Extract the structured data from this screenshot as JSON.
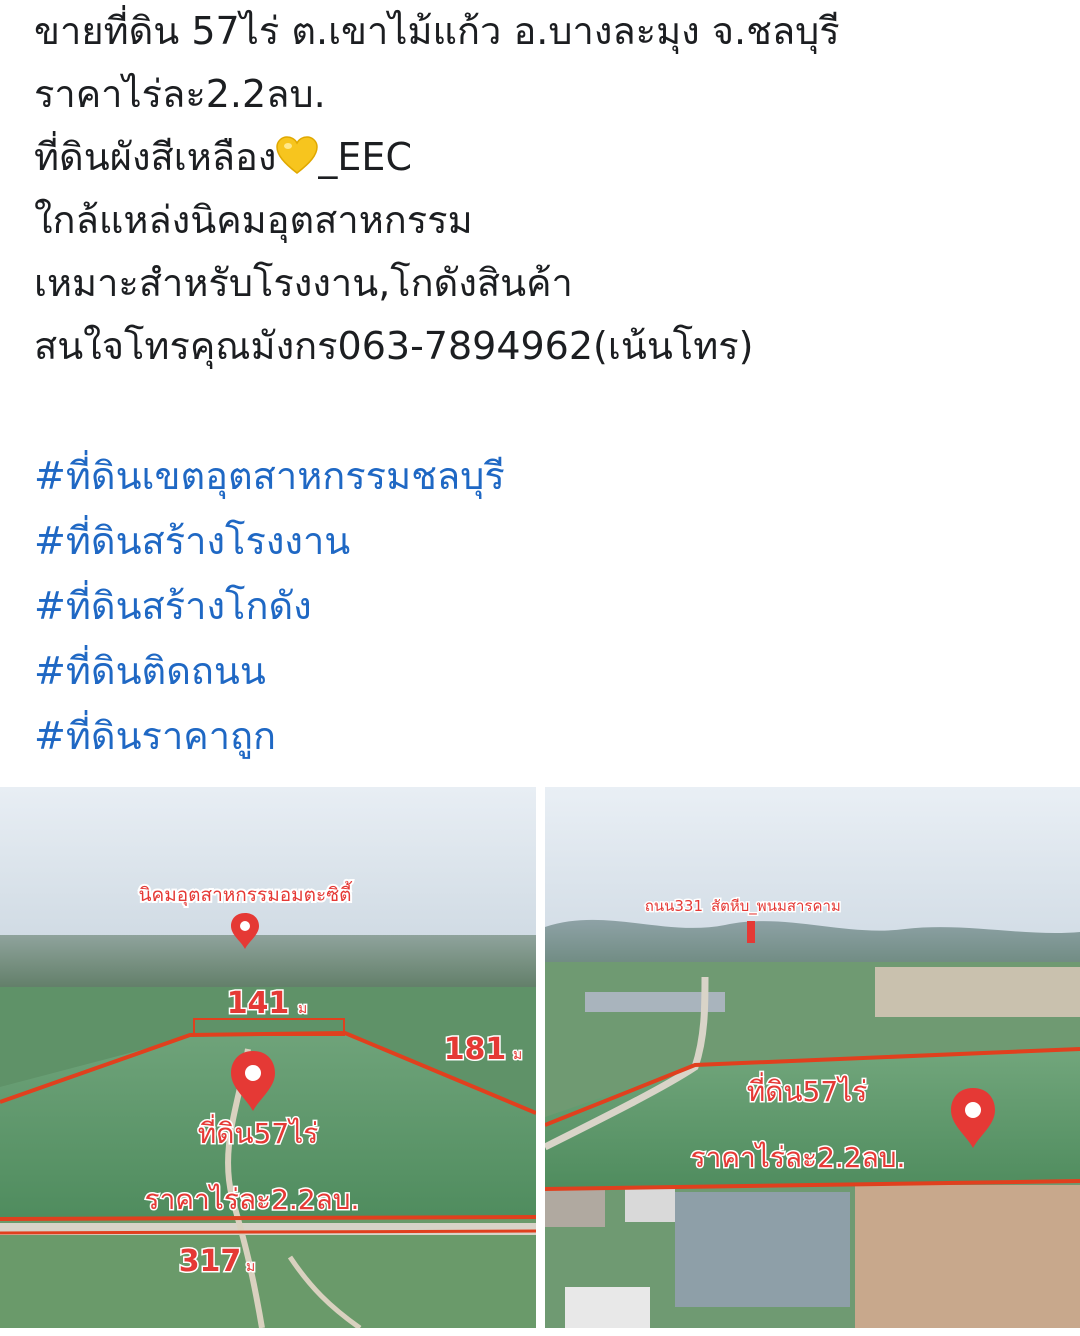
{
  "post": {
    "lines": [
      "ขายที่ดิน 57ไร่ ต.เขาไม้แก้ว อ.บางละมุง จ.ชลบุรี",
      "ราคาไร่ละ2.2ลบ.",
      "ที่ดินผังสีเหลือง",
      "ใกล้แหล่งนิคมอุตสาหกรรม",
      "เหมาะสำหรับโรงงาน,โกดังสินค้า",
      "สนใจโทรคุณมังกร063-7894962(เน้นโทร)"
    ],
    "line3_suffix": "_EEC",
    "hashtags": [
      "#ที่ดินเขตอุตสาหกรรมชลบุรี",
      "#ที่ดินสร้างโรงงาน",
      "#ที่ดินสร้างโกดัง",
      "#ที่ดินติดถนน",
      "#ที่ดินราคาถูก"
    ],
    "hashtag_color": "#1f68c4",
    "heart_icon": "yellow-heart-icon"
  },
  "photos": [
    {
      "landmark_label": "นิคมอุตสาหกรรมอมตะซิตี้",
      "top_width": "141",
      "right_width": "181",
      "bottom_width": "317",
      "unit": "ม",
      "plot_label": "ที่ดิน57ไร่",
      "price_label": "ราคาไร่ละ2.2ลบ."
    },
    {
      "road_label": "ถนน331",
      "road_route": "สัตหีบ_พนมสารคาม",
      "plot_label": "ที่ดิน57ไร่",
      "price_label": "ราคาไร่ละ2.2ลบ."
    }
  ],
  "colors": {
    "text": "#1c1e21",
    "marker": "#e53935",
    "boundary": "#e0401e",
    "label_red": "#e53935"
  }
}
